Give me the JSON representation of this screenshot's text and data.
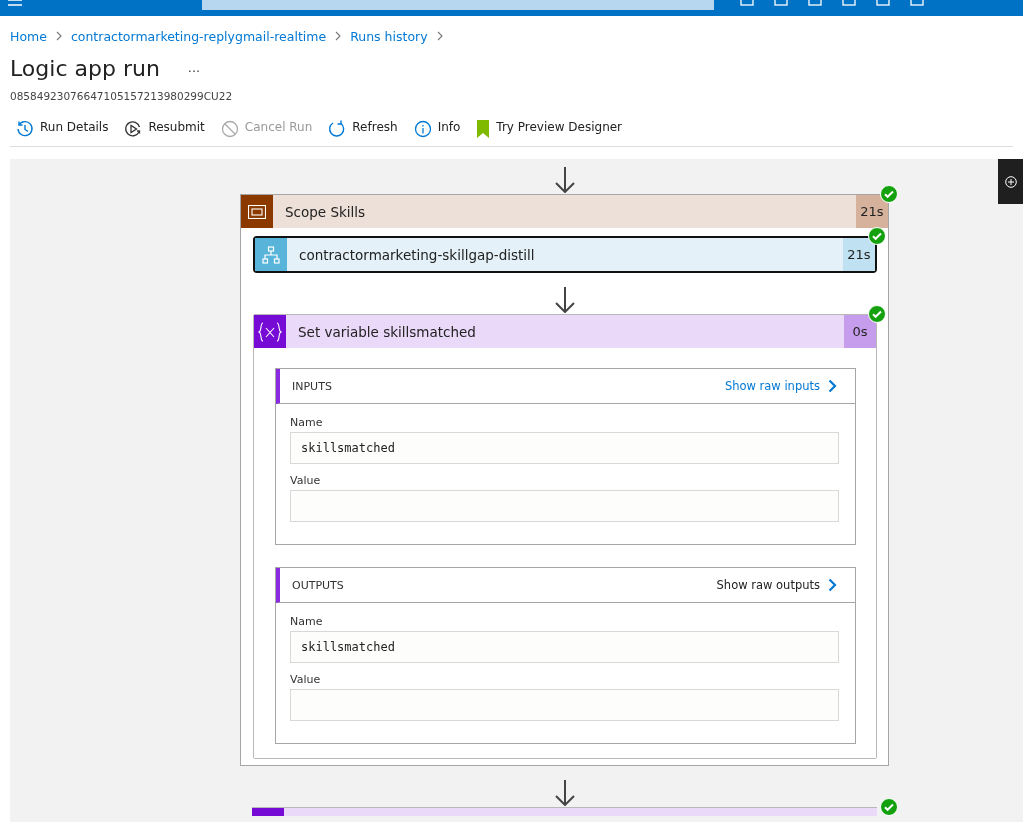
{
  "breadcrumb": [
    "Home",
    "contractormarketing-replygmail-realtime",
    "Runs history"
  ],
  "title": "Logic app run",
  "more_label": "···",
  "run_id": "08584923076647105157213980299CU22",
  "toolbar": [
    {
      "kind": "history",
      "label": "Run Details",
      "disabled": false
    },
    {
      "kind": "resubmit",
      "label": "Resubmit",
      "disabled": false
    },
    {
      "kind": "cancel",
      "label": "Cancel Run",
      "disabled": true
    },
    {
      "kind": "refresh",
      "label": "Refresh",
      "disabled": false
    },
    {
      "kind": "info",
      "label": "Info",
      "disabled": false
    },
    {
      "kind": "bookmark",
      "label": "Try Preview Designer",
      "disabled": false
    }
  ],
  "flow": {
    "scope": {
      "title": "Scope Skills",
      "duration": "21s",
      "succeeded": true,
      "actions": [
        {
          "kind": "workflow",
          "title": "contractormarketing-skillgap-distill",
          "duration": "21s",
          "succeeded": true,
          "selected": true
        },
        {
          "kind": "variable",
          "title": "Set variable skillsmatched",
          "duration": "0s",
          "succeeded": true,
          "selected": false,
          "sections": [
            {
              "heading": "INPUTS",
              "link": "Show raw inputs",
              "fields": [
                {
                  "label": "Name",
                  "value": "skillsmatched"
                },
                {
                  "label": "Value"
                }
              ]
            },
            {
              "heading": "OUTPUTS",
              "link": "Show raw outputs",
              "fields": [
                {
                  "label": "Name",
                  "value": "skillsmatched"
                },
                {
                  "label": "Value"
                }
              ]
            }
          ]
        }
      ]
    },
    "next_action": {
      "kind": "variable",
      "succeeded": true
    }
  }
}
